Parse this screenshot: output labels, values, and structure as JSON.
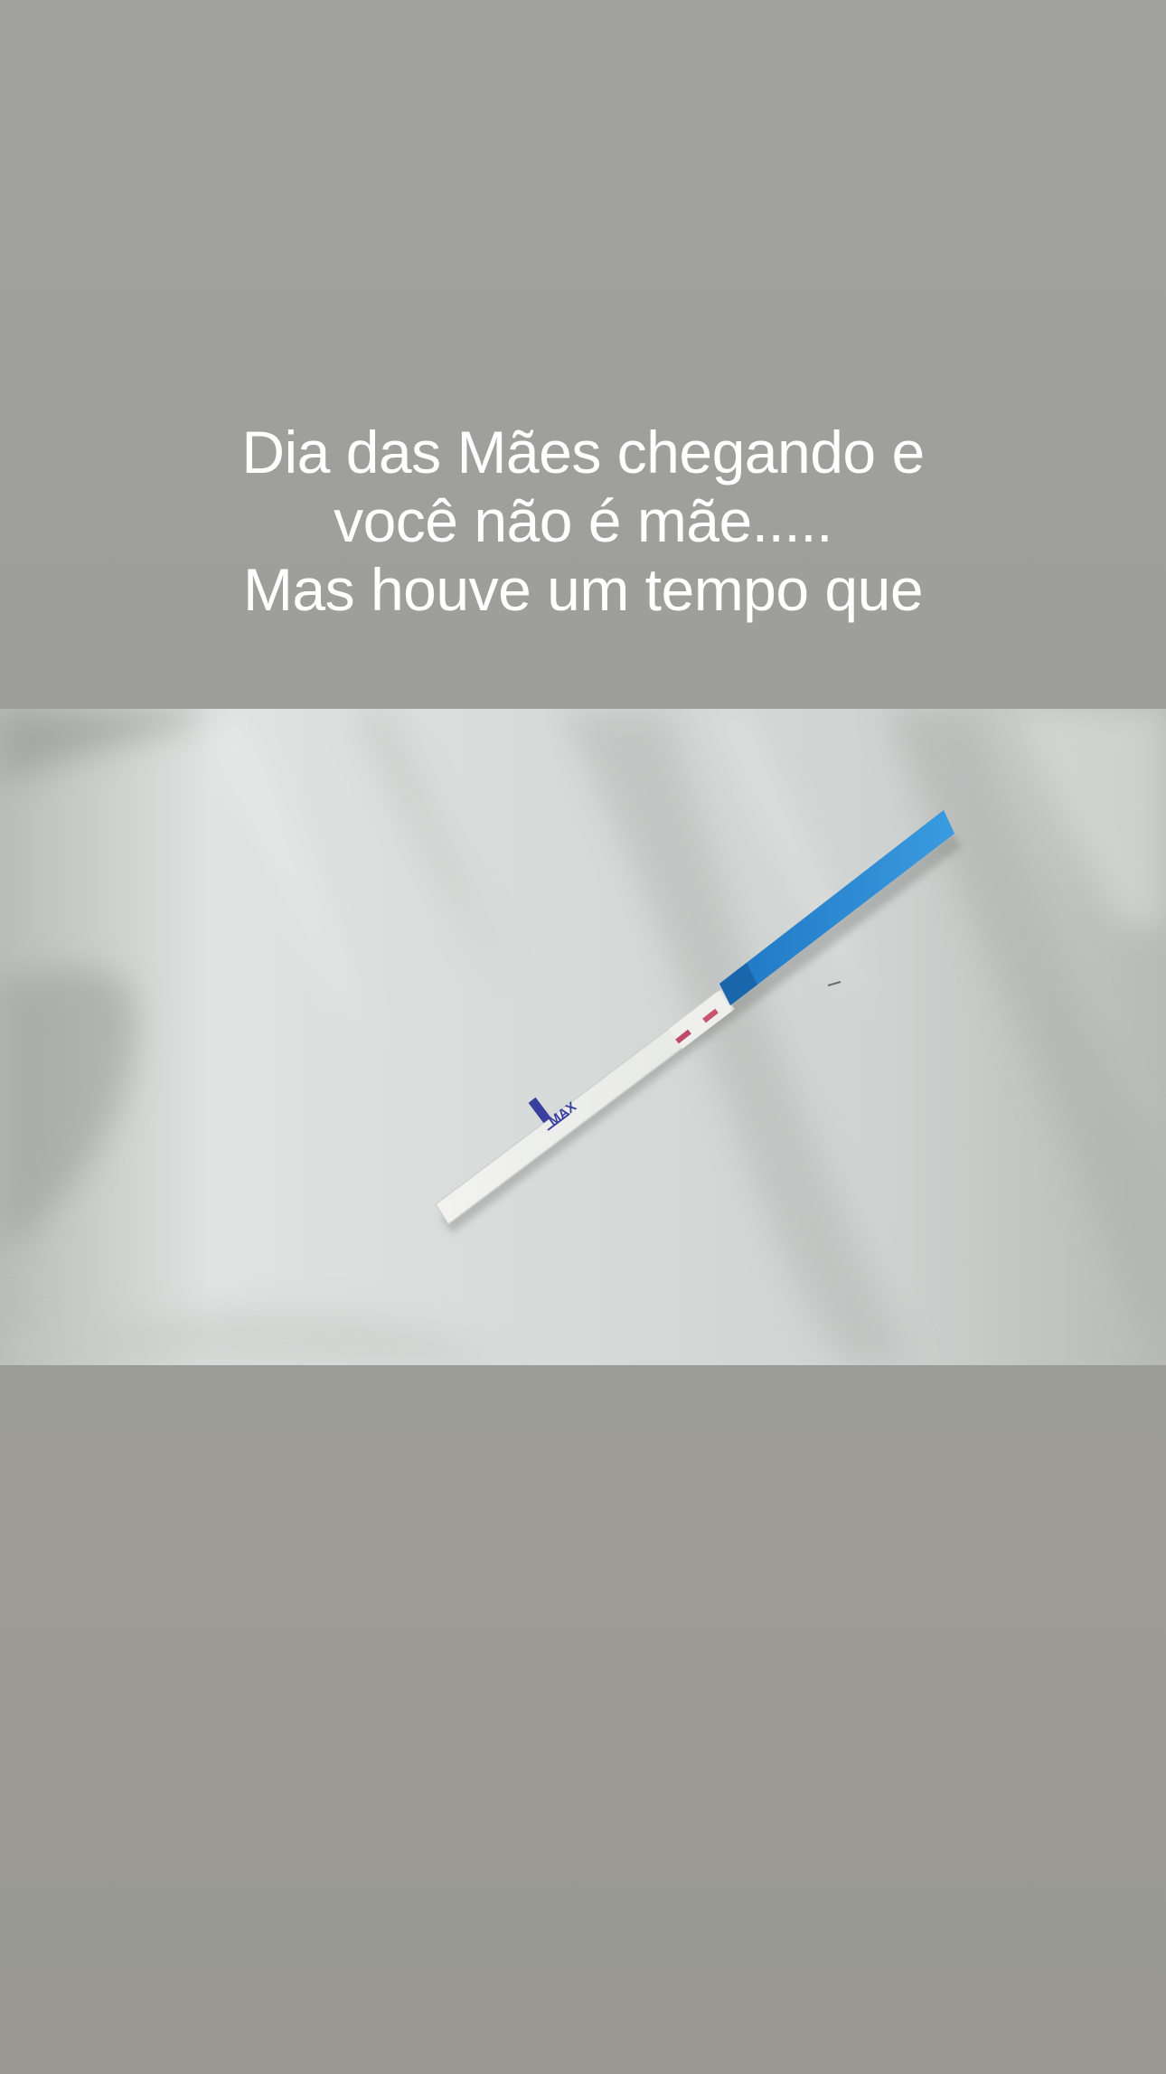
{
  "caption": {
    "line1": "Dia das Mães chegando e",
    "line2": "você não é mãe.....",
    "line3": "Mas houve um tempo que"
  },
  "photo": {
    "subject": "pregnancy-test-strip",
    "strip_text": "MAX"
  },
  "colors": {
    "background": "#9f9f9b",
    "caption": "#ffffff",
    "strip_blue": "#2f8ad4",
    "test_line": "#c04a6a"
  }
}
